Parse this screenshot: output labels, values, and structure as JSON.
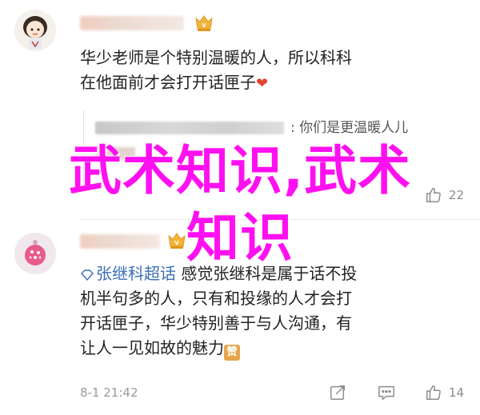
{
  "comments": [
    {
      "username": "",
      "body_line1": "华少老师是个特别温暖的人，所以科科",
      "body_line2": "在他面前才会打开话匣子",
      "quote": {
        "text": ": 你们是更温暖人儿"
      },
      "time": "",
      "like_count": "22",
      "avatar_icon": "cartoon-girl-avatar-icon"
    },
    {
      "username": "",
      "topic": "张继科超话",
      "body_line1_rest": " 感觉张继科是属于话不投",
      "body_line2": "机半句多的人，只有和投缘的人才会打",
      "body_line3": "开话匣子，华少特别善于与人沟通，有",
      "body_line4": "让人一见如故的魅力",
      "emoji": "赞",
      "time": "8-1 21:42",
      "like_count": "14",
      "avatar_icon": "pink-pattern-avatar-icon"
    }
  ],
  "overlay": {
    "line1": "武术知识,武术",
    "line2": "知识"
  },
  "colors": {
    "overlay": "#ff10f0",
    "topic_link": "#3b6fb6",
    "heart": "#e0452f"
  }
}
